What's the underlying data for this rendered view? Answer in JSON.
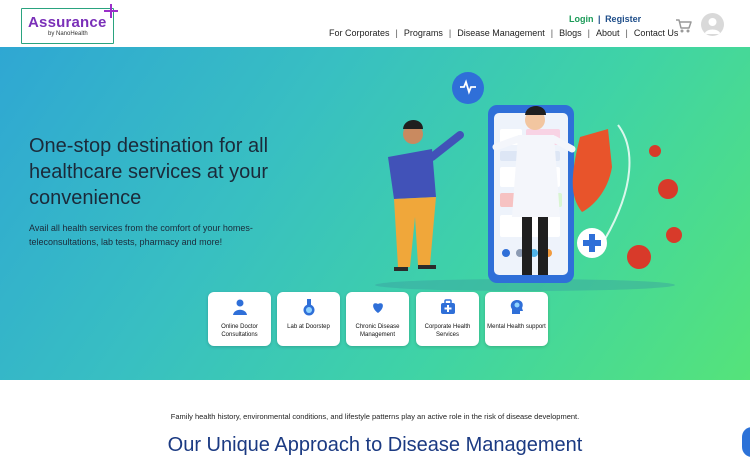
{
  "logo": {
    "name": "Assurance",
    "byline": "by NanoHealth"
  },
  "auth": {
    "login": "Login",
    "separator": "|",
    "register": "Register"
  },
  "nav": {
    "items": [
      "For Corporates",
      "Programs",
      "Disease Management",
      "Blogs",
      "About",
      "Contact Us"
    ]
  },
  "hero": {
    "title": "One-stop destination for all healthcare services at your convenience",
    "subtitle": "Avail all health services from the comfort of your homes- teleconsultations, lab tests, pharmacy and more!",
    "services": [
      {
        "label": "Online Doctor Consultations",
        "icon": "doctor-icon"
      },
      {
        "label": "Lab at Doorstep",
        "icon": "flask-icon"
      },
      {
        "label": "Chronic Disease Management",
        "icon": "heart-hands-icon"
      },
      {
        "label": "Corporate Health Services",
        "icon": "medical-bag-icon"
      },
      {
        "label": "Mental Health support",
        "icon": "brain-head-icon"
      }
    ]
  },
  "section": {
    "note": "Family health history, environmental conditions, and lifestyle patterns play an active role in the risk of disease development.",
    "title": "Our Unique Approach to Disease Management"
  },
  "colors": {
    "brand_purple": "#7a2fb8",
    "login_green": "#1a9a57",
    "navy": "#1b3a82"
  }
}
